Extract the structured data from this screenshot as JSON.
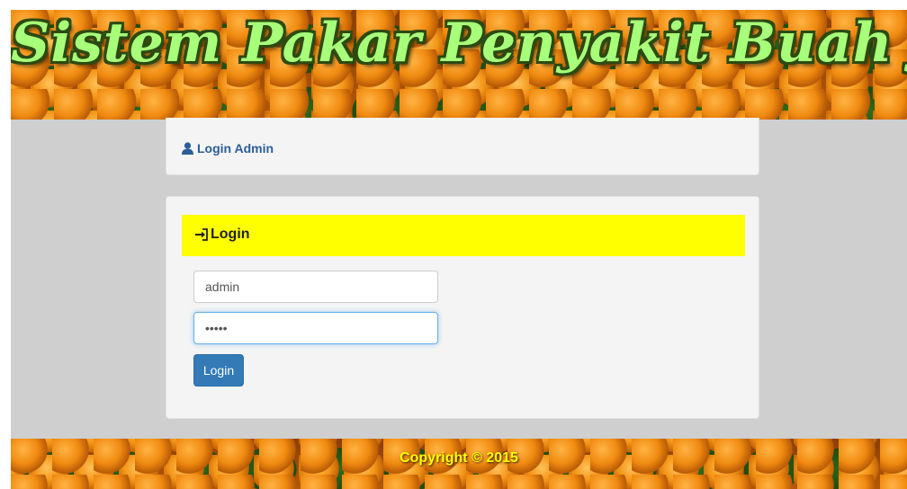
{
  "header": {
    "title": "Sistem Pakar Penyakit Buah Jeruk"
  },
  "nav": {
    "admin_link_label": "Login Admin",
    "admin_link_icon": "user-icon"
  },
  "login_panel": {
    "heading": "Login",
    "heading_icon": "sign-in-icon",
    "heading_bg": "#ffff00",
    "username_value": "admin",
    "password_value": "•••••",
    "submit_label": "Login",
    "submit_color": "#337ab7"
  },
  "footer": {
    "copyright": "Copyright © 2015"
  }
}
